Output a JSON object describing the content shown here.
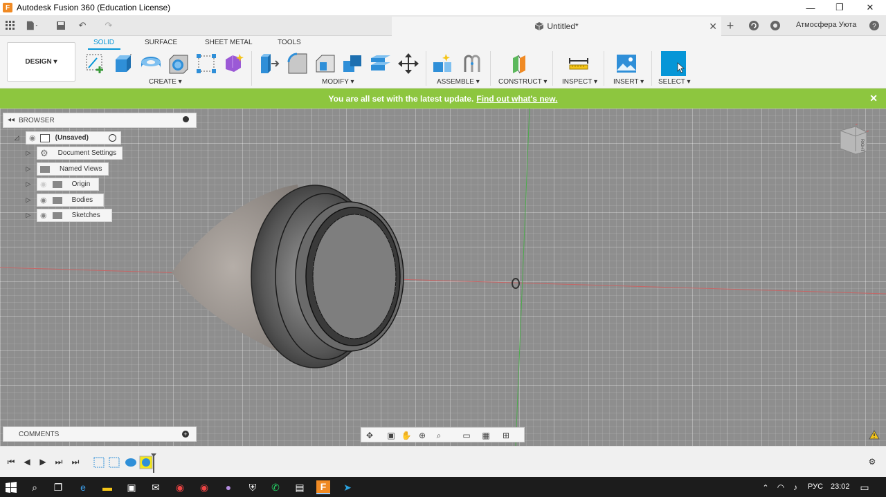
{
  "window": {
    "app_logo": "F",
    "title": "Autodesk Fusion 360 (Education License)",
    "minimize": "—",
    "restore": "❐",
    "close": "✕"
  },
  "quickbar": {
    "document_title": "Untitled*",
    "user_name": "Атмосфера Уюта"
  },
  "toolbar": {
    "workspace": "DESIGN ▾",
    "tabs": [
      "SOLID",
      "SURFACE",
      "SHEET METAL",
      "TOOLS"
    ],
    "groups": [
      "CREATE ▾",
      "MODIFY ▾",
      "ASSEMBLE ▾",
      "CONSTRUCT ▾",
      "INSPECT ▾",
      "INSERT ▾",
      "SELECT ▾"
    ]
  },
  "banner": {
    "message": "You are all set with the latest update.",
    "link": "Find out what's new."
  },
  "browser": {
    "title": "BROWSER",
    "root": "(Unsaved)",
    "items": [
      "Document Settings",
      "Named Views",
      "Origin",
      "Bodies",
      "Sketches"
    ]
  },
  "comments": {
    "title": "COMMENTS"
  },
  "viewcube": {
    "label": "RIGHT"
  },
  "taskbar": {
    "language": "РУС",
    "time": "23:02"
  },
  "colors": {
    "accent": "#0696d7",
    "banner": "#8dc63f",
    "canvas": "#8e8e8e"
  }
}
